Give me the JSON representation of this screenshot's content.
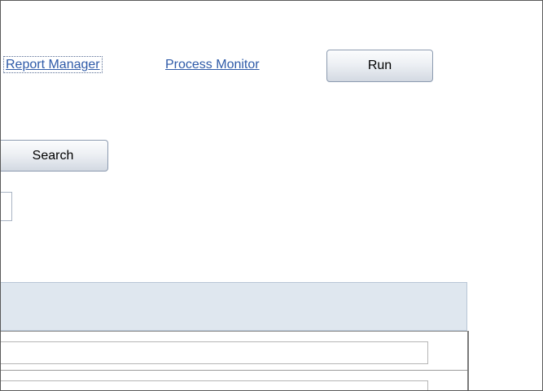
{
  "toolbar": {
    "report_manager_label": "Report Manager",
    "process_monitor_label": "Process Monitor",
    "run_label": "Run"
  },
  "search": {
    "search_label": "Search"
  },
  "grid": {
    "rows": [
      {
        "value": ""
      },
      {
        "value": ""
      }
    ]
  }
}
